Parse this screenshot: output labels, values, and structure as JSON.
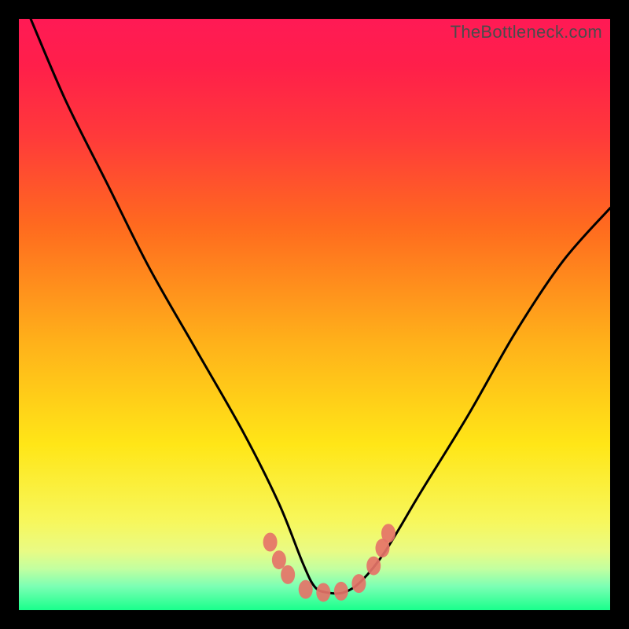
{
  "watermark": "TheBottleneck.com",
  "chart_data": {
    "type": "line",
    "title": "",
    "xlabel": "",
    "ylabel": "",
    "xlim": [
      0,
      100
    ],
    "ylim": [
      0,
      100
    ],
    "grid": false,
    "legend": false,
    "series": [
      {
        "name": "bottleneck-curve",
        "x": [
          2,
          8,
          15,
          22,
          30,
          38,
          44,
          48,
          50,
          52,
          55,
          58,
          62,
          68,
          76,
          84,
          92,
          100
        ],
        "y": [
          100,
          86,
          72,
          58,
          44,
          30,
          18,
          8,
          4,
          3,
          3,
          5,
          10,
          20,
          33,
          47,
          59,
          68
        ]
      }
    ],
    "markers": [
      {
        "x": 42.5,
        "y": 11.5
      },
      {
        "x": 44.0,
        "y": 8.5
      },
      {
        "x": 45.5,
        "y": 6.0
      },
      {
        "x": 48.5,
        "y": 3.5
      },
      {
        "x": 51.5,
        "y": 3.0
      },
      {
        "x": 54.5,
        "y": 3.2
      },
      {
        "x": 57.5,
        "y": 4.5
      },
      {
        "x": 60.0,
        "y": 7.5
      },
      {
        "x": 61.5,
        "y": 10.5
      },
      {
        "x": 62.5,
        "y": 13.0
      }
    ],
    "background_gradient": {
      "top": "#ff1a55",
      "mid": "#ffe617",
      "bottom": "#19ff8c"
    }
  }
}
